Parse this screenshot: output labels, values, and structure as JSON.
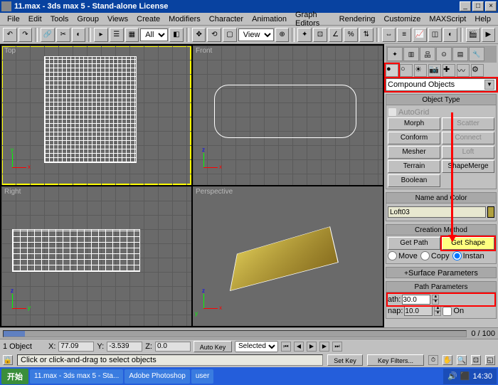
{
  "titlebar": {
    "title": "11.max - 3ds max 5 - Stand-alone License"
  },
  "menu": [
    "File",
    "Edit",
    "Tools",
    "Group",
    "Views",
    "Create",
    "Modifiers",
    "Character",
    "Animation",
    "Graph Editors",
    "Rendering",
    "Customize",
    "MAXScript",
    "Help"
  ],
  "toolbar": {
    "selection_set": "All",
    "ref_coord": "View"
  },
  "viewports": {
    "top": "Top",
    "front": "Front",
    "right": "Right",
    "perspective": "Perspective"
  },
  "panel": {
    "category": "Compound Objects",
    "object_type_title": "Object Type",
    "autogrid": "AutoGrid",
    "buttons": {
      "morph": "Morph",
      "scatter": "Scatter",
      "conform": "Conform",
      "connect": "Connect",
      "mesher": "Mesher",
      "loft": "Loft",
      "terrain": "Terrain",
      "shapemerge": "ShapeMerge",
      "boolean": "Boolean"
    },
    "name_title": "Name and Color",
    "name_value": "Loft03",
    "creation_title": "Creation Method",
    "get_path": "Get Path",
    "get_shape": "Get Shape",
    "move": "Move",
    "copy": "Copy",
    "instance": "Instan",
    "surface_title": "Surface Parameters",
    "path_title": "Path Parameters",
    "path_label": "ath:",
    "path_value": "30.0",
    "snap_label": "nap:",
    "snap_value": "10.0",
    "on_label": "On"
  },
  "timeline": {
    "frame": "0 / 100"
  },
  "status": {
    "object_count": "1 Object",
    "x_label": "X:",
    "x_value": "77.09",
    "y_label": "Y:",
    "y_value": "-3.539",
    "z_label": "Z:",
    "z_value": "0.0",
    "auto_key": "Auto Key",
    "set_key": "Set Key",
    "selected": "Selected",
    "key_filters": "Key Filters...",
    "prompt": "Click or click-and-drag to select objects"
  },
  "taskbar": {
    "start": "开始",
    "tasks": [
      "11.max - 3ds max 5 - Sta...",
      "Adobe Photoshop",
      "user"
    ],
    "time": "14:30"
  }
}
